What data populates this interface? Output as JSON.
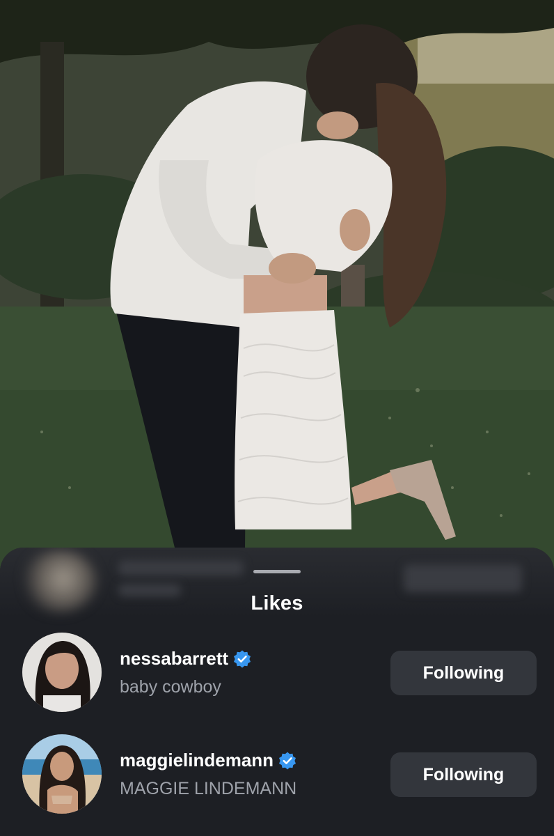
{
  "sheet": {
    "title": "Likes"
  },
  "likes": [
    {
      "username": "nessabarrett",
      "subtitle": "baby cowboy",
      "verified": true,
      "button_label": "Following"
    },
    {
      "username": "maggielindemann",
      "subtitle": "MAGGIE LINDEMANN",
      "verified": true,
      "button_label": "Following"
    }
  ],
  "colors": {
    "sheet_bg": "#1d1f24",
    "button_bg": "#33363c",
    "verified_blue": "#3897f0",
    "subtitle_gray": "#9ea2aa"
  }
}
